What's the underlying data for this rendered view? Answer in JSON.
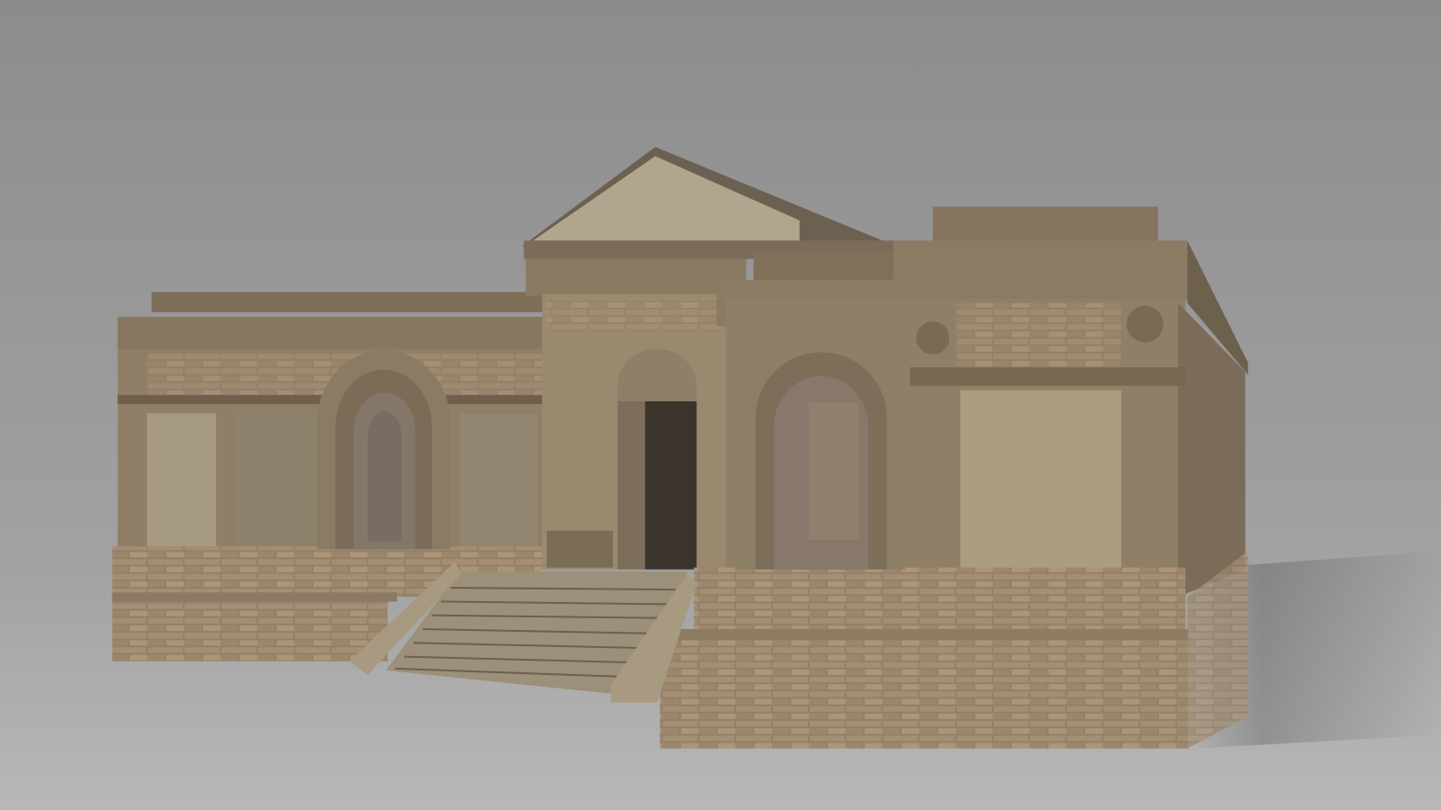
{
  "scene": {
    "subject": "classical-stone-temple-render",
    "colors": {
      "sky_top": "#8c8c8c",
      "sky_bottom": "#a4a4a4",
      "floor": "#b4b4b4",
      "stone_light": "#a89a80",
      "stone_mid": "#8a7a62",
      "stone_dark": "#5e5242",
      "brick": "#94806a",
      "doorway": "#3a342c"
    }
  }
}
